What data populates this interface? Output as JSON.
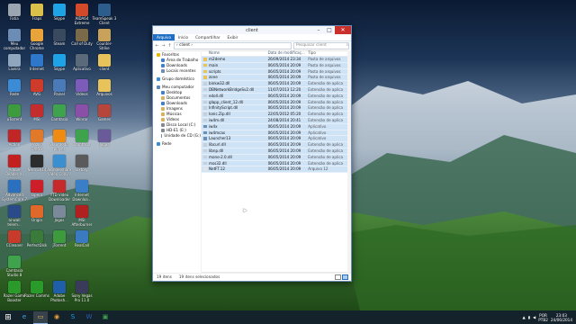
{
  "window": {
    "title": "client",
    "minimize": "–",
    "maximize": "□",
    "close": "✕"
  },
  "ribbon": [
    "Arquivo",
    "Início",
    "Compartilhar",
    "Exibir"
  ],
  "address": {
    "back": "←",
    "forward": "→",
    "up": "↑",
    "path": "› client ›",
    "search_placeholder": "Pesquisar client"
  },
  "nav_pane": [
    {
      "label": "Favoritos",
      "level": 0,
      "color": "#e8b800"
    },
    {
      "label": "Área de Trabalho",
      "level": 1,
      "color": "#3d7fd1"
    },
    {
      "label": "Downloads",
      "level": 1,
      "color": "#3d7fd1"
    },
    {
      "label": "Locais recentes",
      "level": 1,
      "color": "#6b8db5"
    },
    {
      "label": "Grupo doméstico",
      "level": 0,
      "color": "#3b8bd6",
      "gap": true
    },
    {
      "label": "Meu computador",
      "level": 0,
      "color": "#5c85b8",
      "gap": true
    },
    {
      "label": "Desktop",
      "level": 1,
      "color": "#3d7fd1"
    },
    {
      "label": "Documentos",
      "level": 1,
      "color": "#d7b25a"
    },
    {
      "label": "Downloads",
      "level": 1,
      "color": "#3d7fd1"
    },
    {
      "label": "Imagens",
      "level": 1,
      "color": "#d7b25a"
    },
    {
      "label": "Músicas",
      "level": 1,
      "color": "#d7b25a"
    },
    {
      "label": "Vídeos",
      "level": 1,
      "color": "#d7b25a"
    },
    {
      "label": "Disco Local (C:)",
      "level": 1,
      "color": "#7f8a95"
    },
    {
      "label": "HD-E1 (E:)",
      "level": 1,
      "color": "#7f8a95"
    },
    {
      "label": "Unidade de CD (G:)",
      "level": 1,
      "color": "#7f8a95"
    },
    {
      "label": "Rede",
      "level": 0,
      "color": "#3b8bd6",
      "gap": true
    }
  ],
  "columns": [
    "Nome",
    "Data de modificaç...",
    "Tipo"
  ],
  "files": [
    {
      "name": "m2demo",
      "date": "26/09/2014 23:34",
      "type": "Pasta de arquivos",
      "icon": "#e8c25a"
    },
    {
      "name": "main",
      "date": "06/05/2014 20:09",
      "type": "Pasta de arquivos",
      "icon": "#e8c25a"
    },
    {
      "name": "scripts",
      "date": "06/05/2014 20:09",
      "type": "Pasta de arquivos",
      "icon": "#e8c25a"
    },
    {
      "name": "zone",
      "date": "06/05/2014 20:09",
      "type": "Pasta de arquivos",
      "icon": "#e8c25a"
    },
    {
      "name": "binkw32.dll",
      "date": "06/05/2014 20:09",
      "type": "Extensão de aplica",
      "icon": "#c8cfd8"
    },
    {
      "name": "DBNetworkBridgeSv2.dll",
      "date": "11/07/2013 12:20",
      "type": "Extensão de aplica",
      "icon": "#c8cfd8"
    },
    {
      "name": "edoll.dll",
      "date": "06/05/2014 20:09",
      "type": "Extensão de aplica",
      "icon": "#c8cfd8"
    },
    {
      "name": "glapp_client_12.dll",
      "date": "06/05/2014 20:09",
      "type": "Extensão de aplica",
      "icon": "#c8cfd8"
    },
    {
      "name": "InfinityScript.dll",
      "date": "06/05/2014 20:09",
      "type": "Extensão de aplica",
      "icon": "#c8cfd8"
    },
    {
      "name": "Ionic.Zip.dll",
      "date": "22/05/2012 05:20",
      "type": "Extensão de aplica",
      "icon": "#c8cfd8"
    },
    {
      "name": "iw4m.dll",
      "date": "24/08/2014 20:41",
      "type": "Extensão de aplica",
      "icon": "#c8cfd8"
    },
    {
      "name": "iw4x",
      "date": "06/05/2014 20:09",
      "type": "Aplicativo",
      "icon": "#6a8fb5"
    },
    {
      "name": "iw4mcas",
      "date": "06/05/2014 20:09",
      "type": "Aplicativo",
      "icon": "#6a8fb5"
    },
    {
      "name": "Launcher13",
      "date": "06/05/2014 20:09",
      "type": "Aplicativo",
      "icon": "#6a8fb5"
    },
    {
      "name": "libcurl.dll",
      "date": "06/05/2014 20:09",
      "type": "Extensão de aplica",
      "icon": "#c8cfd8"
    },
    {
      "name": "libnp.dll",
      "date": "06/05/2014 20:09",
      "type": "Extensão de aplica",
      "icon": "#c8cfd8"
    },
    {
      "name": "mono-2.0.dll",
      "date": "06/05/2014 20:09",
      "type": "Extensão de aplica",
      "icon": "#c8cfd8"
    },
    {
      "name": "mss32.dll",
      "date": "06/05/2014 20:09",
      "type": "Extensão de aplica",
      "icon": "#c8cfd8"
    },
    {
      "name": "NetFT.12",
      "date": "06/05/2014 20:09",
      "type": "Arquivo 12",
      "icon": "#e4e4e4"
    }
  ],
  "status": {
    "count": "19 itens",
    "selected": "19 itens selecionados"
  },
  "desktop_icons": [
    {
      "label": "Fatia",
      "color": "#9aa5b1"
    },
    {
      "label": "Fraps",
      "color": "#d8c04a"
    },
    {
      "label": "Skype",
      "color": "#1ea3e6"
    },
    {
      "label": "AIDA64 Extreme",
      "color": "#d34a2a"
    },
    {
      "label": "TeamSpeak 3 Client",
      "color": "#2c5d8c"
    },
    {
      "label": "Meu computador",
      "color": "#6b8db5"
    },
    {
      "label": "Google Chrome",
      "color": "#e8a33a"
    },
    {
      "label": "Steam",
      "color": "#3a4a5e"
    },
    {
      "label": "Call of Duty",
      "color": "#7a6a4a"
    },
    {
      "label": "Counter-Strike",
      "color": "#c8a25a"
    },
    {
      "label": "Lixeira",
      "color": "#8fa6bf"
    },
    {
      "label": "Internet",
      "color": "#2e77c9"
    },
    {
      "label": "Skype",
      "color": "#1ea3e6"
    },
    {
      "label": "Aplicativo",
      "color": "#5a6a7a"
    },
    {
      "label": "client",
      "color": "#e8c25a"
    },
    {
      "label": "Rede",
      "color": "#3b8bd6"
    },
    {
      "label": "AVG",
      "color": "#cf3b2b"
    },
    {
      "label": "Painel",
      "color": "#4a7ab8"
    },
    {
      "label": "Vídeos",
      "color": "#7c5cb8"
    },
    {
      "label": "Arquivos",
      "color": "#e8c25a"
    },
    {
      "label": "uTorrent",
      "color": "#3d9a3d"
    },
    {
      "label": "MSI",
      "color": "#c42d2d"
    },
    {
      "label": "Camtasia",
      "color": "#3fa34d"
    },
    {
      "label": "Winrar",
      "color": "#8a4fa6"
    },
    {
      "label": "Games",
      "color": "#b8453a"
    },
    {
      "label": "Action",
      "color": "#c02626"
    },
    {
      "label": "Mozilla Firefox",
      "color": "#e0792a"
    },
    {
      "label": "VLC media player",
      "color": "#ef8a12"
    },
    {
      "label": "Camtasia",
      "color": "#3fa34d"
    },
    {
      "label": "Jogos",
      "color": "#6a5a9a"
    },
    {
      "label": "Adobe Reader XI",
      "color": "#c42020"
    },
    {
      "label": "Nero 2014",
      "color": "#2c2c2c"
    },
    {
      "label": "Wondershare Video Conv...",
      "color": "#3a8fd0"
    },
    {
      "label": "Dxtory",
      "color": "#5a5a5a"
    },
    {
      "label": "",
      "color": "transparent"
    },
    {
      "label": "Advanced SystemCare 7",
      "color": "#2b6fbf"
    },
    {
      "label": "Opera",
      "color": "#cc1f2a"
    },
    {
      "label": "YTD Video Downloader",
      "color": "#c62a2a"
    },
    {
      "label": "Internet Downloa...",
      "color": "#3a7ec8"
    },
    {
      "label": "",
      "color": "transparent"
    },
    {
      "label": "ai-wall telem...",
      "color": "#2a4a8a"
    },
    {
      "label": "Origin",
      "color": "#e0682a"
    },
    {
      "label": "Jogos",
      "color": "#7a8a9a"
    },
    {
      "label": "MSI Afterburner",
      "color": "#b02020"
    },
    {
      "label": "",
      "color": "transparent"
    },
    {
      "label": "CCleaner",
      "color": "#c83a2a"
    },
    {
      "label": "PerfectDisk",
      "color": "#3a7a3a"
    },
    {
      "label": "jTorrent",
      "color": "#3d9a3d"
    },
    {
      "label": "RealCall",
      "color": "#3a7ac0"
    },
    {
      "label": "",
      "color": "transparent"
    },
    {
      "label": "Camtasia Studio 8",
      "color": "#3fa34d"
    },
    {
      "label": "",
      "color": "transparent"
    },
    {
      "label": "",
      "color": "transparent"
    },
    {
      "label": "",
      "color": "transparent"
    },
    {
      "label": "",
      "color": "transparent"
    },
    {
      "label": "Razer Game Booster",
      "color": "#2a9a2a"
    },
    {
      "label": "Razer Comms",
      "color": "#2a9a2a"
    },
    {
      "label": "Adobe Photosh...",
      "color": "#1f5ea8"
    },
    {
      "label": "Sony Vegas Pro 11.0",
      "color": "#3a3a5a"
    }
  ],
  "taskbar": {
    "start": "⊞",
    "items": [
      {
        "name": "ie",
        "glyph": "e",
        "color": "#4aa3e0"
      },
      {
        "name": "explorer",
        "glyph": "▭",
        "color": "#e8c25a",
        "active": true
      },
      {
        "name": "chrome",
        "glyph": "◉",
        "color": "#e8a33a"
      },
      {
        "name": "skype",
        "glyph": "S",
        "color": "#1ea3e6"
      },
      {
        "name": "word",
        "glyph": "W",
        "color": "#2b5fb0"
      },
      {
        "name": "camtasia",
        "glyph": "▣",
        "color": "#3fa34d"
      }
    ],
    "lang": {
      "line1": "POR",
      "line2": "PTB2"
    },
    "clock": {
      "time": "23:03",
      "date": "24/06/2014"
    }
  }
}
